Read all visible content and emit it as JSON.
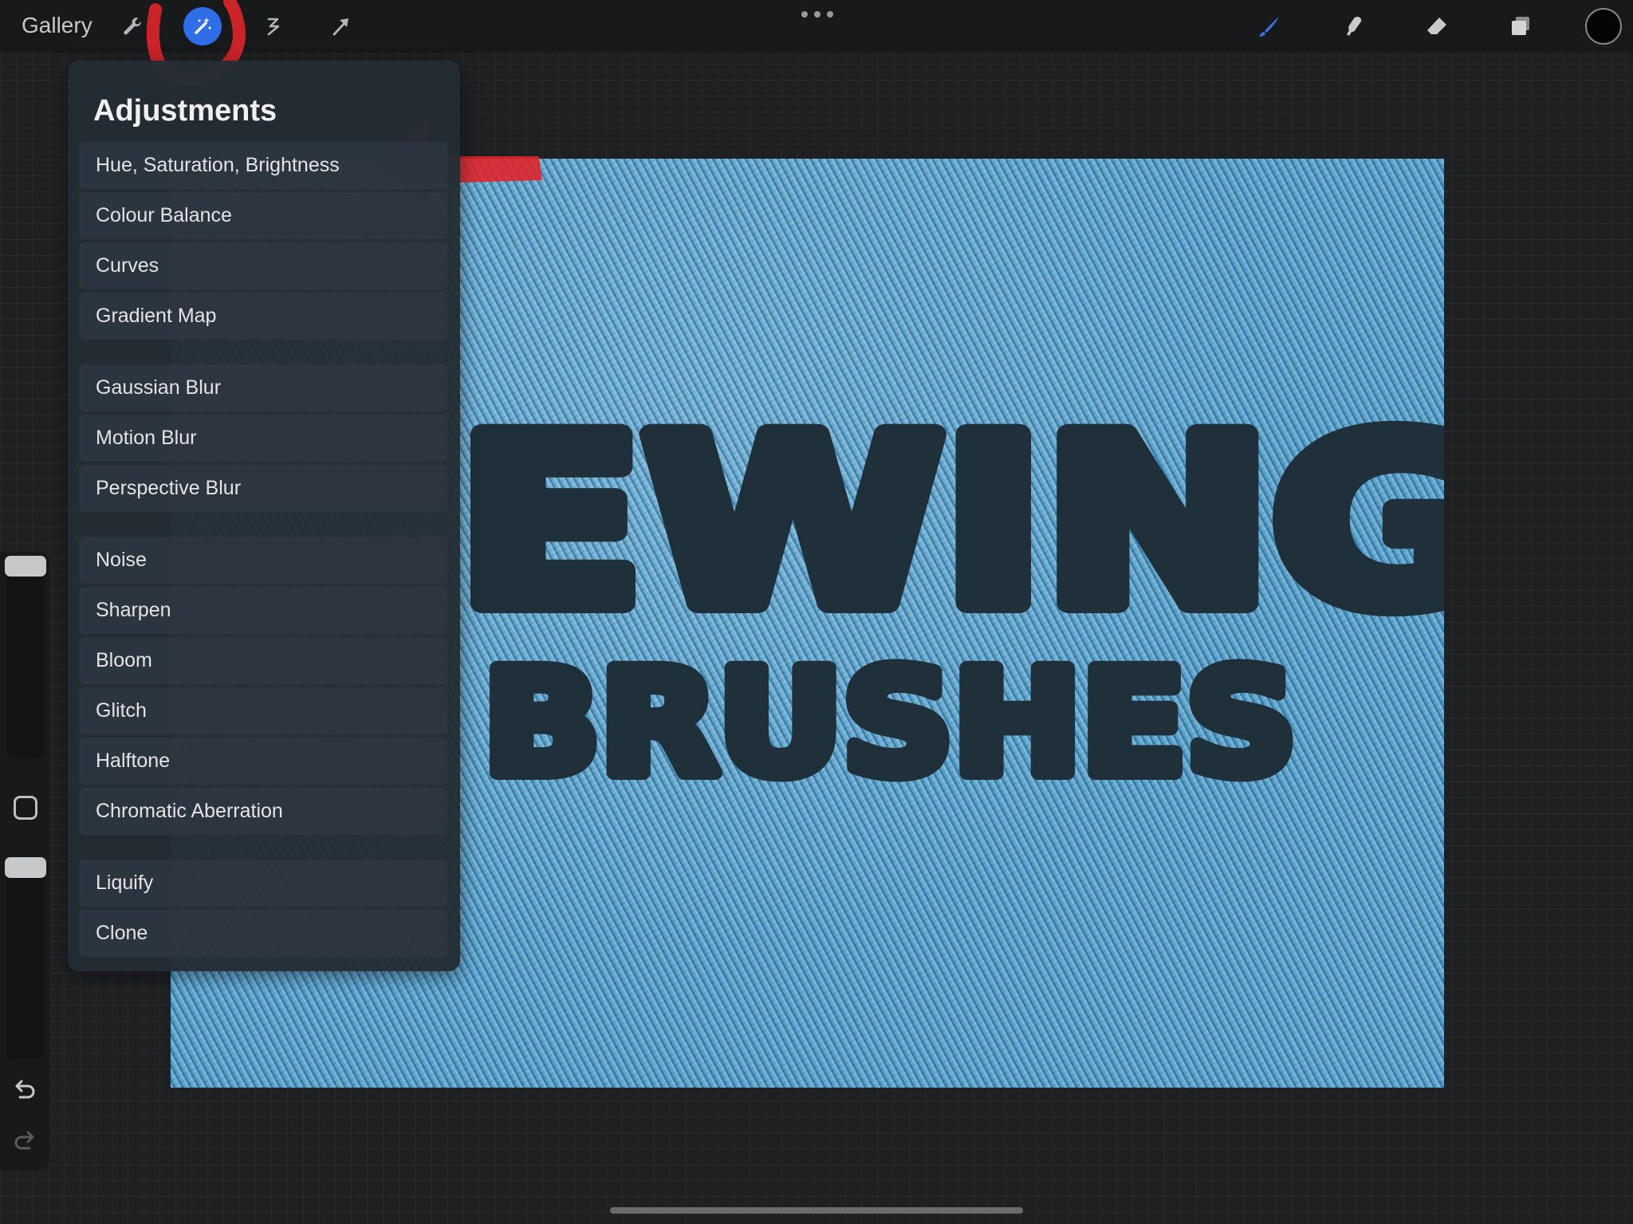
{
  "toolbar": {
    "gallery_label": "Gallery",
    "tools_left": [
      "wrench-icon",
      "magic-wand-icon",
      "selection-icon",
      "transform-arrow-icon"
    ],
    "active_tool": "magic-wand-icon",
    "tools_right": [
      "brush-icon",
      "smudge-icon",
      "eraser-icon",
      "layers-icon",
      "color-picker"
    ],
    "brush_color": "#3a6fe0",
    "current_color": "#050505"
  },
  "adjustments": {
    "title": "Adjustments",
    "groups": [
      [
        "Hue, Saturation, Brightness",
        "Colour Balance",
        "Curves",
        "Gradient Map"
      ],
      [
        "Gaussian Blur",
        "Motion Blur",
        "Perspective Blur"
      ],
      [
        "Noise",
        "Sharpen",
        "Bloom",
        "Glitch",
        "Halftone",
        "Chromatic Aberration"
      ],
      [
        "Liquify",
        "Clone"
      ]
    ]
  },
  "canvas": {
    "line1": "EWING",
    "line2": "BRUSHES",
    "texture_color": "#4a98c4",
    "ink_color": "#20303a"
  },
  "sidebar": {
    "undo_icon": "undo-icon",
    "redo_icon": "redo-icon"
  },
  "annotation_color": "#e0252b"
}
